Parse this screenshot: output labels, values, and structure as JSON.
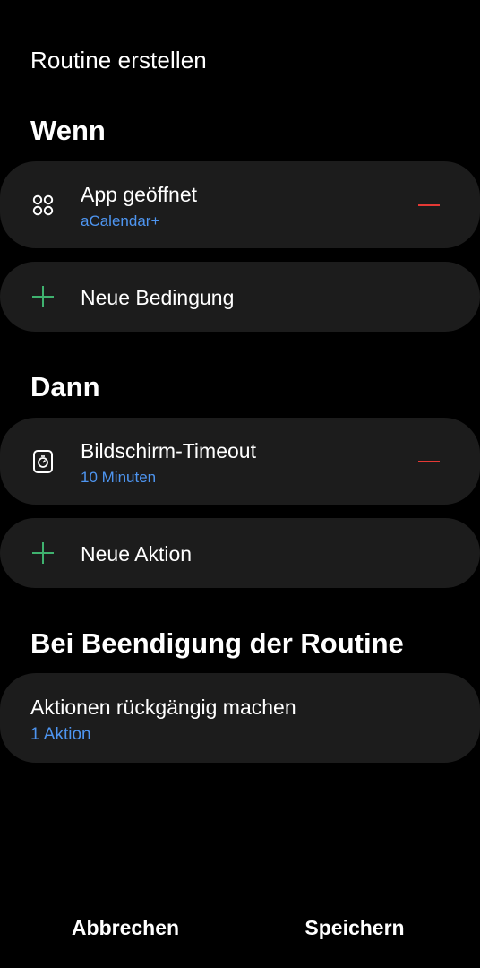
{
  "header": {
    "title": "Routine erstellen"
  },
  "when_section": {
    "title": "Wenn",
    "condition": {
      "icon": "apps-grid-icon",
      "label": "App geöffnet",
      "value": "aCalendar+"
    },
    "add_label": "Neue Bedingung"
  },
  "then_section": {
    "title": "Dann",
    "action": {
      "icon": "screen-timeout-icon",
      "label": "Bildschirm-Timeout",
      "value": "10 Minuten"
    },
    "add_label": "Neue Aktion"
  },
  "end_section": {
    "title": "Bei Beendigung der Routine",
    "undo_label": "Aktionen rückgängig machen",
    "undo_value": "1 Aktion"
  },
  "footer": {
    "cancel_label": "Abbrechen",
    "save_label": "Speichern"
  },
  "colors": {
    "background": "#000000",
    "card": "#1c1c1c",
    "accent_blue": "#4e95f0",
    "add_green": "#3fb26f",
    "remove_red": "#e53935"
  }
}
